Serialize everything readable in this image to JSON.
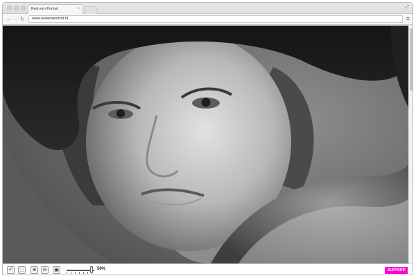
{
  "window": {
    "tab_title": "Red een Portret",
    "tab_close": "×",
    "url": "www.redeenportret.nl"
  },
  "icons": {
    "back": "←",
    "forward": "→",
    "reload": "↻",
    "menu": "≡",
    "fullscreen": "⤢"
  },
  "viewer": {
    "tools": [
      {
        "name": "rotate-icon",
        "glyph": "↶"
      },
      {
        "name": "crop-icon",
        "glyph": "⬚"
      },
      {
        "name": "zoom-in-icon",
        "glyph": "⊕"
      },
      {
        "name": "zoom-out-icon",
        "glyph": "⊖"
      },
      {
        "name": "image-icon",
        "glyph": "▣"
      }
    ],
    "zoom_label": "50%",
    "zoom_fraction": 0.9,
    "support_label": "SUPPORT",
    "support_close": "×",
    "colors": {
      "support": "#ff00d4"
    }
  }
}
